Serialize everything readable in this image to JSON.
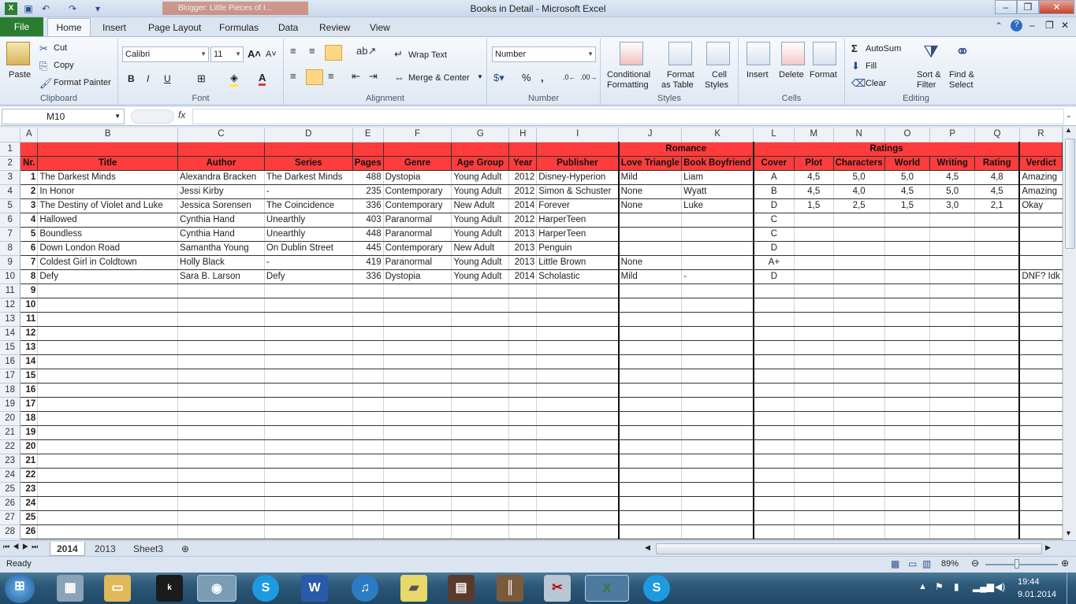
{
  "window": {
    "title": "Books in Detail  -  Microsoft Excel",
    "blog_tab": "Blogger: Little Pieces of I..."
  },
  "tabs": [
    "File",
    "Home",
    "Insert",
    "Page Layout",
    "Formulas",
    "Data",
    "Review",
    "View"
  ],
  "ribbon": {
    "clipboard": {
      "label": "Clipboard",
      "paste": "Paste",
      "cut": "Cut",
      "copy": "Copy",
      "format_painter": "Format Painter"
    },
    "font": {
      "label": "Font",
      "name": "Calibri",
      "size": "11",
      "bold": "B",
      "italic": "I",
      "underline": "U"
    },
    "alignment": {
      "label": "Alignment",
      "wrap": "Wrap Text",
      "merge": "Merge & Center"
    },
    "number": {
      "label": "Number",
      "format": "Number"
    },
    "styles": {
      "label": "Styles",
      "conditional": "Conditional",
      "conditional2": "Formatting",
      "format_table": "Format",
      "format_table2": "as Table",
      "cell_styles": "Cell",
      "cell_styles2": "Styles"
    },
    "cells": {
      "label": "Cells",
      "insert": "Insert",
      "delete": "Delete",
      "format": "Format"
    },
    "editing": {
      "label": "Editing",
      "autosum": "AutoSum",
      "fill": "Fill",
      "clear": "Clear",
      "sort": "Sort &",
      "sort2": "Filter",
      "find": "Find &",
      "find2": "Select"
    }
  },
  "formula_bar": {
    "name_box": "M10",
    "fx": "fx",
    "value": ""
  },
  "columns": [
    "A",
    "B",
    "C",
    "D",
    "E",
    "F",
    "G",
    "H",
    "I",
    "J",
    "K",
    "L",
    "M",
    "N",
    "O",
    "P",
    "Q",
    "R"
  ],
  "header_row1": {
    "romance": "Romance",
    "ratings": "Ratings"
  },
  "header_row2": [
    "Nr.",
    "Title",
    "Author",
    "Series",
    "Pages",
    "Genre",
    "Age Group",
    "Year",
    "Publisher",
    "Love Triangle",
    "Book Boyfriend",
    "Cover",
    "Plot",
    "Characters",
    "World",
    "Writing",
    "Rating",
    "Verdict"
  ],
  "rows": [
    [
      "1",
      "The Darkest Minds",
      "Alexandra Bracken",
      "The Darkest Minds",
      "488",
      "Dystopia",
      "Young Adult",
      "2012",
      "Disney-Hyperion",
      "Mild",
      "Liam",
      "A",
      "4,5",
      "5,0",
      "5,0",
      "4,5",
      "4,8",
      "Amazing"
    ],
    [
      "2",
      "In Honor",
      "Jessi Kirby",
      "-",
      "235",
      "Contemporary",
      "Young Adult",
      "2012",
      "Simon & Schuster",
      "None",
      "Wyatt",
      "B",
      "4,5",
      "4,0",
      "4,5",
      "5,0",
      "4,5",
      "Amazing"
    ],
    [
      "3",
      "The Destiny of Violet and Luke",
      "Jessica Sorensen",
      "The Coincidence",
      "336",
      "Contemporary",
      "New Adult",
      "2014",
      "Forever",
      "None",
      "Luke",
      "D",
      "1,5",
      "2,5",
      "1,5",
      "3,0",
      "2,1",
      "Okay"
    ],
    [
      "4",
      "Hallowed",
      "Cynthia Hand",
      "Unearthly",
      "403",
      "Paranormal",
      "Young Adult",
      "2012",
      "HarperTeen",
      "",
      "",
      "C",
      "",
      "",
      "",
      "",
      "",
      ""
    ],
    [
      "5",
      "Boundless",
      "Cynthia Hand",
      "Unearthly",
      "448",
      "Paranormal",
      "Young Adult",
      "2013",
      "HarperTeen",
      "",
      "",
      "C",
      "",
      "",
      "",
      "",
      "",
      ""
    ],
    [
      "6",
      "Down London Road",
      "Samantha Young",
      "On Dublin Street",
      "445",
      "Contemporary",
      "New Adult",
      "2013",
      "Penguin",
      "",
      "",
      "D",
      "",
      "",
      "",
      "",
      "",
      ""
    ],
    [
      "7",
      "Coldest Girl in Coldtown",
      "Holly Black",
      "-",
      "419",
      "Paranormal",
      "Young Adult",
      "2013",
      "Little Brown",
      "None",
      "",
      "A+",
      "",
      "",
      "",
      "",
      "",
      ""
    ],
    [
      "8",
      "Defy",
      "Sara B. Larson",
      "Defy",
      "336",
      "Dystopia",
      "Young Adult",
      "2014",
      "Scholastic",
      "Mild",
      "-",
      "D",
      "",
      "",
      "",
      "",
      "",
      "DNF? Idk"
    ]
  ],
  "empty_rows": [
    {
      "row": "11",
      "nr": "9"
    },
    {
      "row": "12",
      "nr": "10"
    },
    {
      "row": "13",
      "nr": "11"
    },
    {
      "row": "14",
      "nr": "12"
    },
    {
      "row": "15",
      "nr": "13"
    },
    {
      "row": "16",
      "nr": "14"
    },
    {
      "row": "17",
      "nr": "15"
    },
    {
      "row": "18",
      "nr": "16"
    },
    {
      "row": "19",
      "nr": "17"
    },
    {
      "row": "20",
      "nr": "18"
    },
    {
      "row": "21",
      "nr": "19"
    },
    {
      "row": "22",
      "nr": "20"
    },
    {
      "row": "23",
      "nr": "21"
    },
    {
      "row": "24",
      "nr": "22"
    },
    {
      "row": "25",
      "nr": "23"
    },
    {
      "row": "26",
      "nr": "24"
    },
    {
      "row": "27",
      "nr": "25"
    },
    {
      "row": "28",
      "nr": "26"
    }
  ],
  "sheets": [
    "2014",
    "2013",
    "Sheet3"
  ],
  "status": {
    "ready": "Ready",
    "zoom": "89%"
  },
  "clock": {
    "time": "19:44",
    "date": "9.01.2014"
  },
  "taskbar_apps": [
    "start",
    "calculator",
    "explorer",
    "kindle",
    "chrome",
    "skype",
    "word",
    "itunes",
    "sticky-notes",
    "reader",
    "library",
    "paint",
    "excel",
    "skype2"
  ],
  "colors": {
    "header_red": "#ff3c3c",
    "file_tab": "#2a7d2f"
  }
}
